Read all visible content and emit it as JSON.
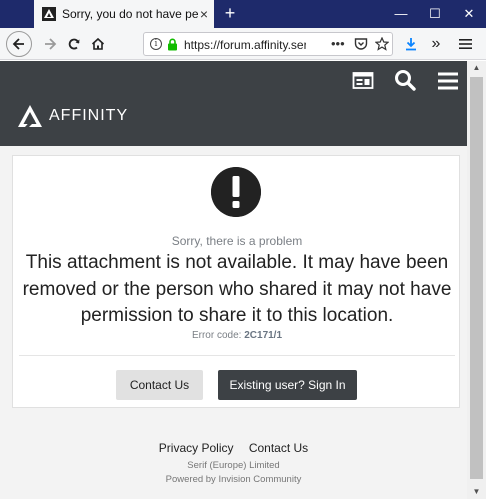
{
  "browser": {
    "tab_title": "Sorry, you do not have permission",
    "url": "https://forum.affinity.serif.com",
    "tab_close": "×",
    "new_tab": "+",
    "window_controls": {
      "minimize": "—",
      "maximize": "☐",
      "close": "✕"
    }
  },
  "site": {
    "logo_text": "AFFINITY"
  },
  "error": {
    "subtitle": "Sorry, there is a problem",
    "message": "This attachment is not available. It may have been removed or the person who shared it may not have permission to share it to this location.",
    "error_code_label": "Error code:",
    "error_code": "2C171/1",
    "buttons": {
      "contact": "Contact Us",
      "signin": "Existing user? Sign In"
    }
  },
  "footer": {
    "privacy": "Privacy Policy",
    "contact": "Contact Us",
    "company": "Serif (Europe) Limited",
    "powered": "Powered by Invision Community"
  }
}
